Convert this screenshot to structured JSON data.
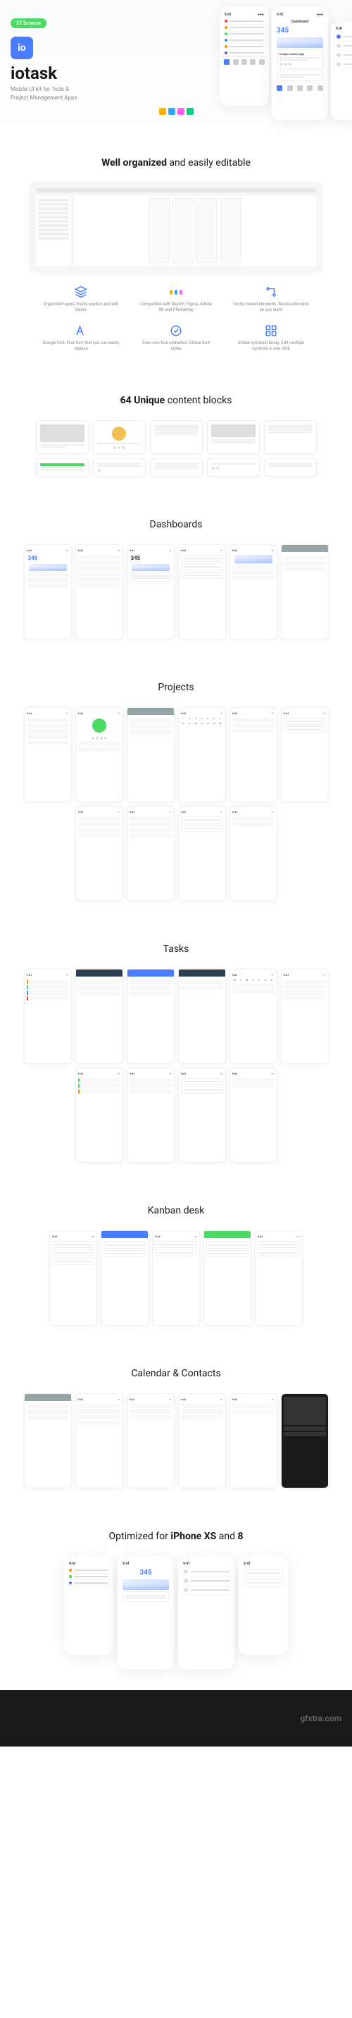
{
  "hero": {
    "badge": "37 Screens",
    "logo": "io",
    "brand": "iotask",
    "tagline": "Mobile UI kit for Todo & Project Management Apps",
    "dashboard_title": "Dashboard",
    "stat": "345",
    "card_title": "Design search page",
    "card_sub": "Integrate form for UX writing the results list create to tell friends"
  },
  "sections": {
    "organized": {
      "title_bold": "Well organized",
      "title_rest": " and easily editable"
    },
    "blocks": {
      "title_bold": "64 Unique",
      "title_rest": " content blocks"
    },
    "dashboards": "Dashboards",
    "projects": "Projects",
    "tasks": "Tasks",
    "kanban": "Kanban desk",
    "calendar": "Calendar & Contacts",
    "optimized": {
      "pre": "Optimized for ",
      "b1": "iPhone XS",
      "mid": " and ",
      "b2": "8"
    }
  },
  "features": [
    {
      "icon": "layers",
      "text": "Organized layers. Easily explore and edit layers"
    },
    {
      "icon": "apps",
      "text": "Compatible with Sketch, Figma, Adobe XD and Photoshop"
    },
    {
      "icon": "vector",
      "text": "Vector based elements. Resize elements as you want"
    },
    {
      "icon": "font",
      "text": "Google font. Free font that you can easily replace"
    },
    {
      "icon": "iconfont",
      "text": "Free icon font embeded. Global font styles"
    },
    {
      "icon": "symbols",
      "text": "Global symbols library. Edit multiple symbols in one click"
    }
  ],
  "tools": [
    {
      "name": "sketch",
      "color": "#fdb300"
    },
    {
      "name": "photoshop",
      "color": "#31a8ff"
    },
    {
      "name": "xd",
      "color": "#ff61f6"
    },
    {
      "name": "figma",
      "color": "#0acf83"
    }
  ],
  "watermark": "gfxtra.com"
}
